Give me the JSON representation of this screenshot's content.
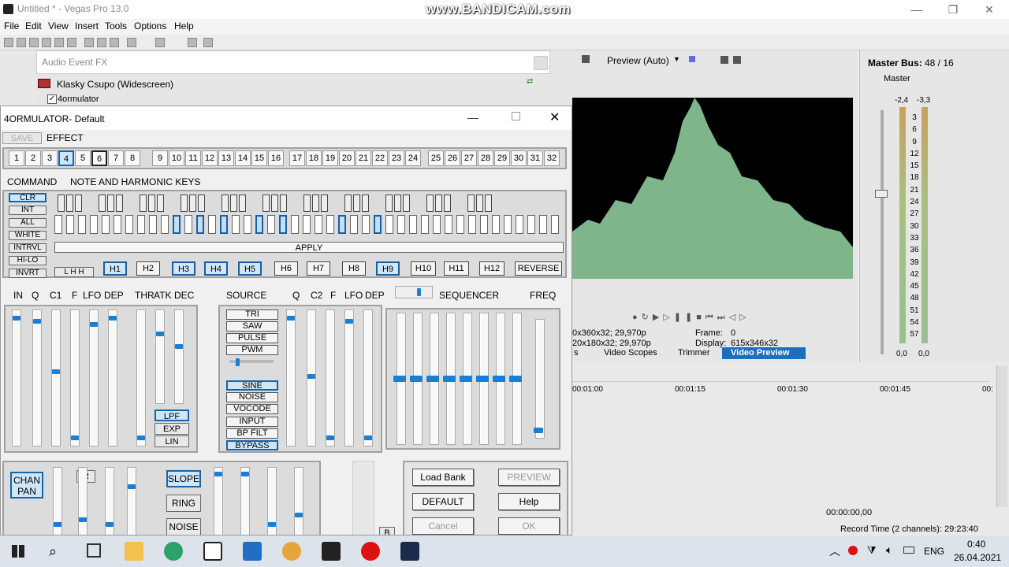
{
  "app": {
    "title": "Untitled * - Vegas Pro 13.0",
    "watermark": "www.BANDICAM.com"
  },
  "menu": [
    "File",
    "Edit",
    "View",
    "Insert",
    "Tools",
    "Options",
    "Help"
  ],
  "fx_window": {
    "title": "Audio Event FX",
    "chain_item": "Klasky Csupo (Widescreen)",
    "plugin_item": "4ormulator"
  },
  "plugin": {
    "title": "4ORMULATOR- Default",
    "save": "SAVE",
    "effect": "EFFECT",
    "presets": [
      "1",
      "2",
      "3",
      "4",
      "5",
      "6",
      "7",
      "8",
      "9",
      "10",
      "11",
      "12",
      "13",
      "14",
      "15",
      "16",
      "17",
      "18",
      "19",
      "20",
      "21",
      "22",
      "23",
      "24",
      "25",
      "26",
      "27",
      "28",
      "29",
      "30",
      "31",
      "32"
    ],
    "command_label": "COMMAND",
    "note_label": "NOTE AND HARMONIC KEYS",
    "commands": [
      "CLR",
      "INT",
      "ALL",
      "WHITE",
      "INTRVL",
      "HI-LO",
      "INVRT"
    ],
    "apply": "APPLY",
    "lhh": "L H H",
    "harmonics": [
      "H1",
      "H2",
      "H3",
      "H4",
      "H5",
      "H6",
      "H7",
      "H8",
      "H9",
      "H10",
      "H11",
      "H12",
      "REVERSE"
    ],
    "fader_labels_1": [
      "IN",
      "Q",
      "C1",
      "F",
      "LFO",
      "DEP"
    ],
    "fader_labels_2": [
      "THR",
      "ATK",
      "DEC"
    ],
    "source_label": "SOURCE",
    "sources": [
      "TRI",
      "SAW",
      "PULSE",
      "PWM",
      "SINE",
      "NOISE",
      "VOCODE",
      "INPUT",
      "BP FILT",
      "BYPASS"
    ],
    "fader_labels_3": [
      "Q",
      "C2",
      "F",
      "LFO",
      "DEP"
    ],
    "sequencer": "SEQUENCER",
    "freq": "FREQ",
    "filters": [
      "LPF",
      "EXP",
      "LIN"
    ],
    "chan_pan": "CHAN PAN",
    "r": "R",
    "slope": "SLOPE",
    "ring": "RING",
    "noise": "NOISE",
    "b": "B",
    "buttons": {
      "load_bank": "Load Bank",
      "preview": "PREVIEW",
      "default": "DEFAULT",
      "help": "Help",
      "cancel": "Cancel",
      "ok": "OK"
    }
  },
  "preview": {
    "mode": "Preview (Auto)",
    "info1": "0x360x32; 29,970p",
    "info2": "20x180x32; 29,970p",
    "frame_label": "Frame:",
    "frame": "0",
    "display_label": "Display:",
    "display": "615x346x32",
    "tabs": [
      "s",
      "Video Scopes",
      "Trimmer",
      "Video Preview"
    ]
  },
  "master": {
    "title": "Master Bus:",
    "count": "48 / 16",
    "label": "Master",
    "peak_l": "-2,4",
    "peak_r": "-3,3",
    "scale": [
      "3",
      "6",
      "9",
      "12",
      "15",
      "18",
      "21",
      "24",
      "27",
      "30",
      "33",
      "36",
      "39",
      "42",
      "45",
      "48",
      "51",
      "54",
      "57"
    ],
    "out_l": "0,0",
    "out_r": "0,0",
    "inf": "∞"
  },
  "timeline": {
    "marks": [
      "00:01:00",
      "00:01:15",
      "00:01:30",
      "00:01:45",
      "00:"
    ],
    "time": "00:00:00,00",
    "record": "Record Time (2 channels): 29:23:40"
  },
  "taskbar": {
    "lang": "ENG",
    "time": "0:40",
    "date": "26.04.2021"
  }
}
